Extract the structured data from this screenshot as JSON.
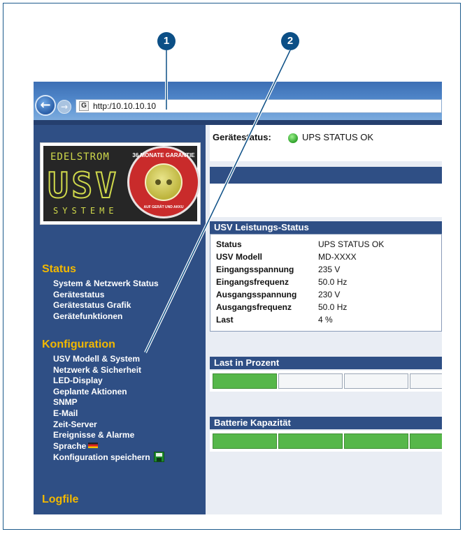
{
  "callouts": [
    "1",
    "2"
  ],
  "browser": {
    "back_icon": "←",
    "forward_icon": "→",
    "site_icon": "G",
    "url": "http:/10.10.10.10"
  },
  "logo": {
    "brand": "EDELSTROM",
    "usv": "USV",
    "systeme": "SYSTEME",
    "badge_top": "36 MONATE GARANTIE",
    "badge_bottom": "AUF GERÄT UND AKKU"
  },
  "device_status": {
    "label": "Gerätestatus:",
    "value": "UPS STATUS OK",
    "indicator_color": "#3fb43a"
  },
  "sidebar": {
    "status_title": "Status",
    "status_items": [
      "System & Netzwerk Status",
      "Gerätestatus",
      "Gerätestatus Grafik",
      "Gerätefunktionen"
    ],
    "config_title": "Konfiguration",
    "config_items": [
      "USV Modell & System",
      "Netzwerk & Sicherheit",
      "LED-Display",
      "Geplante Aktionen",
      "SNMP",
      "E-Mail",
      "Zeit-Server",
      "Ereignisse & Alarme",
      "Sprache",
      "Konfiguration speichern"
    ],
    "logfile_title": "Logfile"
  },
  "performance": {
    "title": "USV Leistungs-Status",
    "rows": [
      {
        "key": "Status",
        "value": "UPS STATUS OK"
      },
      {
        "key": "USV Modell",
        "value": "MD-XXXX"
      },
      {
        "key": "Eingangsspannung",
        "value": "235 V"
      },
      {
        "key": "Eingangsfrequenz",
        "value": "50.0 Hz"
      },
      {
        "key": "Ausgangsspannung",
        "value": "230 V"
      },
      {
        "key": "Ausgangsfrequenz",
        "value": "50.0 Hz"
      },
      {
        "key": "Last",
        "value": "4 %"
      }
    ]
  },
  "load": {
    "title": "Last in Prozent",
    "filled_segments": 1,
    "visible_segments": 4
  },
  "battery": {
    "title": "Batterie Kapazität",
    "filled_segments": 4,
    "visible_segments": 4
  },
  "colors": {
    "sidebar": "#2f4f85",
    "section_title": "#f2b800",
    "callout": "#0c4f86",
    "bar_fill": "#56b74a"
  }
}
